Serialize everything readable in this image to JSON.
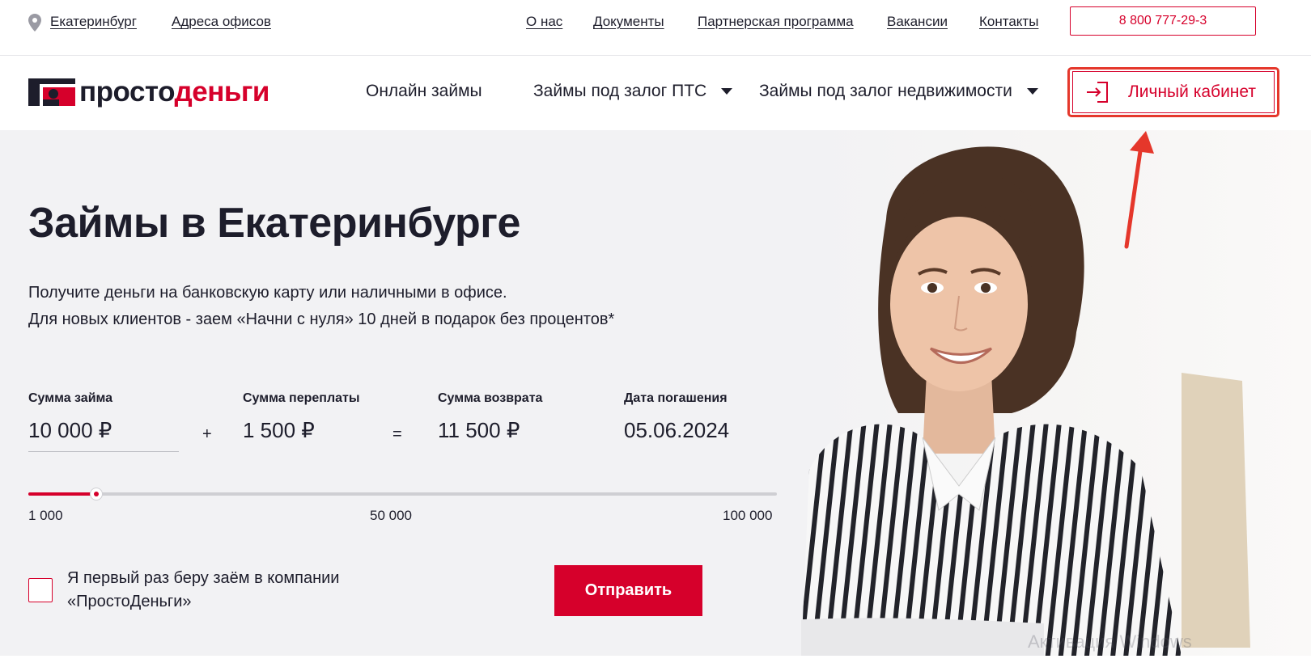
{
  "topbar": {
    "city": "Екатеринбург",
    "offices": "Адреса офисов",
    "links": [
      "О нас",
      "Документы",
      "Партнерская программа",
      "Вакансии",
      "Контакты"
    ],
    "phone": "8 800 777-29-3"
  },
  "nav": {
    "logo_part1": "просто",
    "logo_part2": "деньги",
    "items": [
      "Онлайн займы",
      "Займы под залог ПТС",
      "Займы под залог недвижимости"
    ],
    "cabinet": "Личный кабинет"
  },
  "hero": {
    "title": "Займы в Екатеринбурге",
    "subtitle_line1": "Получите деньги на банковскую карту или наличными в офисе.",
    "subtitle_line2": "Для новых клиентов - заем «Начни с нуля» 10 дней в подарок без процентов*"
  },
  "calculator": {
    "amount_label": "Сумма займа",
    "amount_value": "10 000 ₽",
    "plus": "+",
    "overpay_label": "Сумма переплаты",
    "overpay_value": "1 500 ₽",
    "equals": "=",
    "return_label": "Сумма возврата",
    "return_value": "11 500 ₽",
    "date_label": "Дата погашения",
    "date_value": "05.06.2024"
  },
  "slider": {
    "min_label": "1 000",
    "mid_label": "50 000",
    "max_label": "100 000",
    "min": 1000,
    "max": 100000,
    "value": 10000
  },
  "form": {
    "checkbox_line1": "Я первый раз беру заём в компании",
    "checkbox_line2": "«ПростоДеньги»",
    "checkbox_checked": false,
    "submit": "Отправить"
  },
  "watermark": "Активация Windows",
  "colors": {
    "brand_red": "#d6002b",
    "hero_bg": "#f2f2f4",
    "text": "#1d1d2b",
    "annotation_red": "#e5372b"
  },
  "icons": [
    "location-pin-icon",
    "logo-mark-icon",
    "chevron-down-icon",
    "login-icon",
    "annotation-arrow-icon"
  ]
}
